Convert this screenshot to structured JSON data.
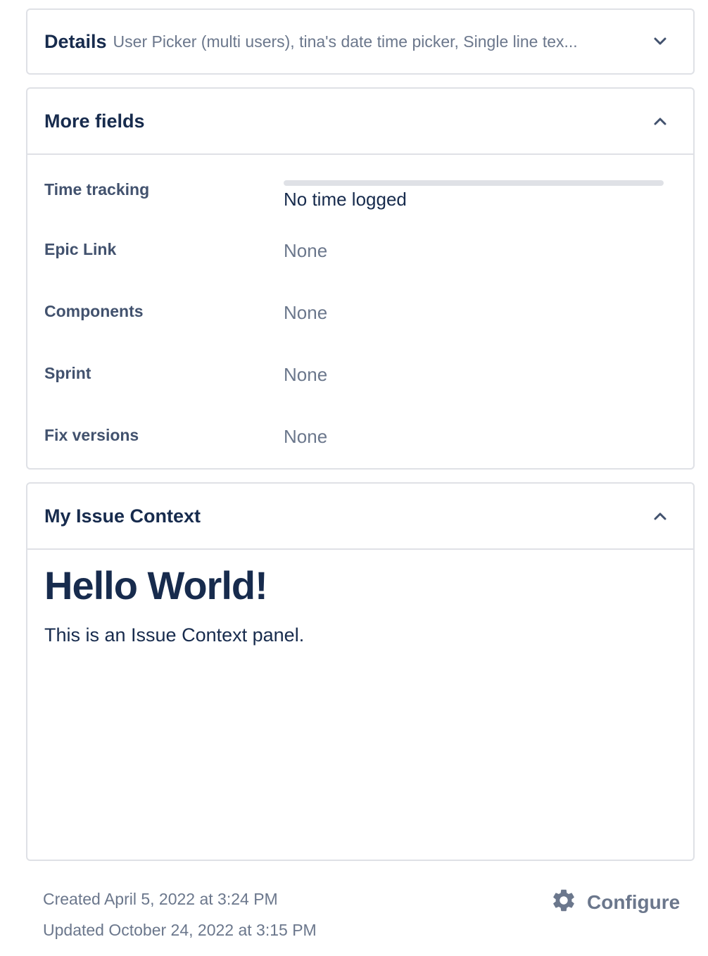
{
  "details": {
    "title": "Details",
    "summary": "User Picker (multi users), tina's date time picker, Single line tex..."
  },
  "more_fields": {
    "title": "More fields",
    "fields": [
      {
        "label": "Time tracking",
        "value": "No time logged",
        "logged_fraction": 0
      },
      {
        "label": "Epic Link",
        "value": "None"
      },
      {
        "label": "Components",
        "value": "None"
      },
      {
        "label": "Sprint",
        "value": "None"
      },
      {
        "label": "Fix versions",
        "value": "None"
      }
    ]
  },
  "issue_context": {
    "title": "My Issue Context",
    "heading": "Hello World!",
    "text": "This is an Issue Context panel."
  },
  "footer": {
    "created": "Created April 5, 2022 at 3:24 PM",
    "updated": "Updated October 24, 2022 at 3:15 PM",
    "configure_label": "Configure",
    "configure_icon": "gear-icon"
  },
  "icons": {
    "details_toggle": "chevron-down-icon",
    "more_fields_toggle": "chevron-up-icon",
    "issue_context_toggle": "chevron-up-icon"
  },
  "colors": {
    "title": "#172b4d",
    "label": "#42526e",
    "muted": "#6b778c",
    "border": "#dfe1e6"
  }
}
